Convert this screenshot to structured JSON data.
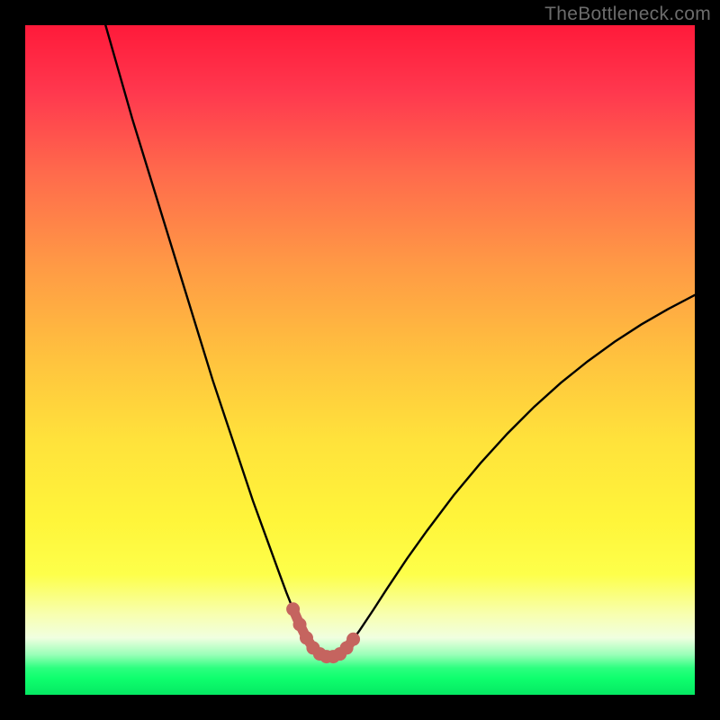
{
  "watermark": "TheBottleneck.com",
  "colors": {
    "frame": "#000000",
    "gradient_top": "#ff1a3a",
    "gradient_mid": "#ffe23b",
    "gradient_bottom": "#05e862",
    "curve_stroke": "#000000",
    "marker_stroke": "#c5645f",
    "marker_fill": "#c5645f"
  },
  "chart_data": {
    "type": "line",
    "title": "",
    "xlabel": "",
    "ylabel": "",
    "xlim": [
      0,
      100
    ],
    "ylim": [
      0,
      100
    ],
    "curve": {
      "x": [
        12,
        14,
        16,
        18,
        20,
        22,
        24,
        26,
        28,
        30,
        32,
        34,
        36,
        38,
        39,
        40,
        41,
        42,
        43,
        44,
        45,
        46,
        47,
        48,
        49,
        50,
        52,
        54,
        57,
        60,
        64,
        68,
        72,
        76,
        80,
        84,
        88,
        92,
        96,
        100
      ],
      "y": [
        100,
        93,
        86,
        79.5,
        73,
        66.5,
        60,
        53.5,
        47,
        41,
        35,
        29,
        23.5,
        18,
        15.3,
        12.8,
        10.5,
        8.5,
        7.0,
        6.1,
        5.7,
        5.7,
        6.1,
        7.0,
        8.3,
        9.7,
        12.7,
        15.8,
        20.3,
        24.5,
        29.8,
        34.6,
        39.0,
        43.0,
        46.6,
        49.8,
        52.7,
        55.3,
        57.6,
        59.7
      ]
    },
    "markers": {
      "x": [
        40,
        41,
        42,
        43,
        44,
        45,
        46,
        47,
        48,
        49
      ],
      "y": [
        12.8,
        10.5,
        8.5,
        7.0,
        6.1,
        5.7,
        5.7,
        6.1,
        7.0,
        8.3
      ]
    }
  }
}
